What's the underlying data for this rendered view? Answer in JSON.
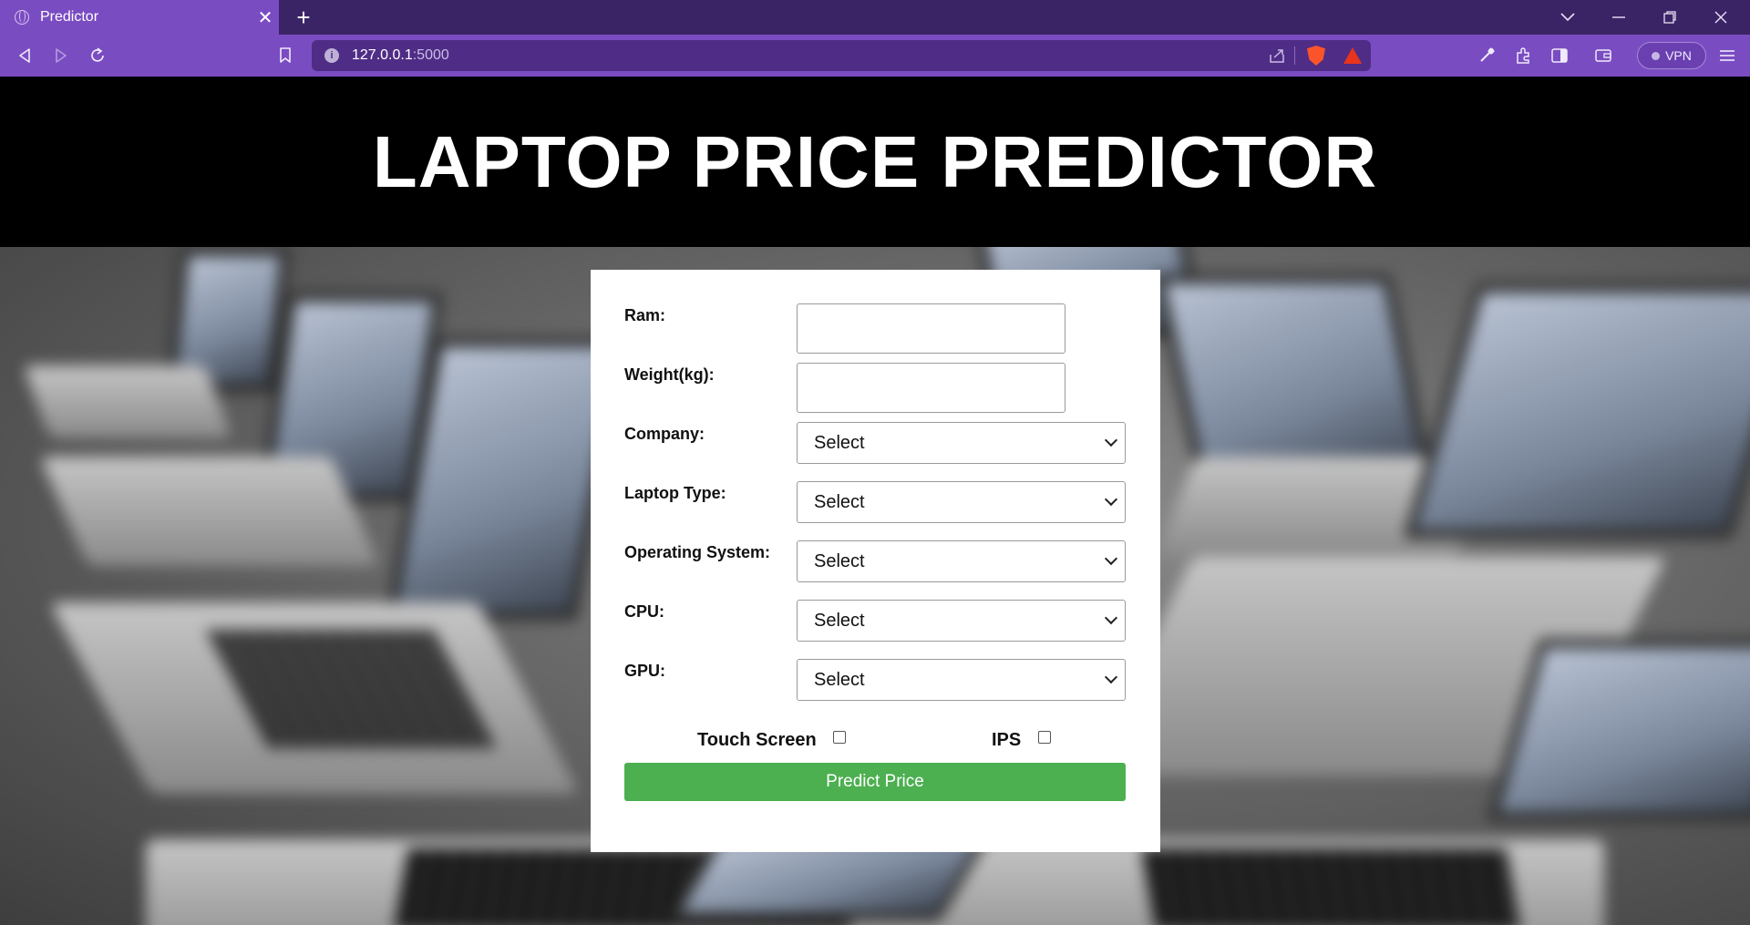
{
  "browser": {
    "tab_title": "Predictor",
    "tab_close": "✕",
    "new_tab": "+",
    "url_host": "127.0.0.1",
    "url_port": ":5000",
    "vpn_label": "VPN",
    "accent": "#7a4cc2"
  },
  "page": {
    "title": "LAPTOP PRICE PREDICTOR"
  },
  "form": {
    "ram_label": "Ram:",
    "ram_value": "",
    "weight_label": "Weight(kg):",
    "weight_value": "",
    "company_label": "Company:",
    "company_selected": "Select",
    "type_label": "Laptop Type:",
    "type_selected": "Select",
    "os_label": "Operating System:",
    "os_selected": "Select",
    "cpu_label": "CPU:",
    "cpu_selected": "Select",
    "gpu_label": "GPU:",
    "gpu_selected": "Select",
    "touch_label": "Touch Screen",
    "touch_checked": false,
    "ips_label": "IPS",
    "ips_checked": false,
    "submit_label": "Predict Price",
    "submit_color": "#4caf50"
  }
}
